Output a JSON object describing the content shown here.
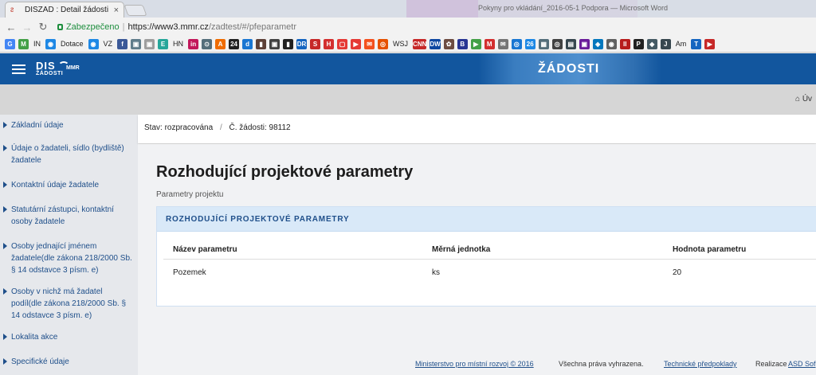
{
  "browser": {
    "tab_title": "DISZAD : Detail žádosti",
    "tab_close": "×",
    "background_window_text": "Pokyny pro vkládání_2016-05-1 Podpora — Microsoft Word",
    "security_label": "Zabezpečeno",
    "url_host": "https://www3.mmr.cz",
    "url_path": "/zadtest/#/pfeparametr",
    "bookmarks": [
      {
        "label": "G",
        "color": "#4285f4"
      },
      {
        "label": "M",
        "color": "#43a047"
      },
      {
        "label": "IN",
        "color": "",
        "text": true
      },
      {
        "label": "◉",
        "color": "#1e88e5"
      },
      {
        "label": "Dotace",
        "color": "",
        "text": true
      },
      {
        "label": "◉",
        "color": "#1e88e5"
      },
      {
        "label": "VZ",
        "color": "",
        "text": true
      },
      {
        "label": "f",
        "color": "#3b5998"
      },
      {
        "label": "▣",
        "color": "#607d8b"
      },
      {
        "label": "▣",
        "color": "#9e9e9e"
      },
      {
        "label": "E",
        "color": "#26a69a"
      },
      {
        "label": "HN",
        "color": "",
        "text": true
      },
      {
        "label": "in",
        "color": "#c2185b"
      },
      {
        "label": "⊙",
        "color": "#546e7a"
      },
      {
        "label": "A",
        "color": "#ef6c00"
      },
      {
        "label": "24",
        "color": "#212121"
      },
      {
        "label": "d",
        "color": "#1976d2"
      },
      {
        "label": "▮",
        "color": "#5d4037"
      },
      {
        "label": "▣",
        "color": "#424242"
      },
      {
        "label": "▮",
        "color": "#212121"
      },
      {
        "label": "DR",
        "color": "#1565c0"
      },
      {
        "label": "S",
        "color": "#c62828"
      },
      {
        "label": "H",
        "color": "#d32f2f"
      },
      {
        "label": "▢",
        "color": "#e53935"
      },
      {
        "label": "▶",
        "color": "#e53935"
      },
      {
        "label": "✉",
        "color": "#f4511e"
      },
      {
        "label": "◎",
        "color": "#e65100"
      },
      {
        "label": "WSJ",
        "color": "",
        "text": true
      },
      {
        "label": "CNN",
        "color": "#c62828"
      },
      {
        "label": "DW",
        "color": "#0d47a1"
      },
      {
        "label": "✿",
        "color": "#6d4c41"
      },
      {
        "label": "B",
        "color": "#283593"
      },
      {
        "label": "▶",
        "color": "#43a047"
      },
      {
        "label": "M",
        "color": "#d32f2f"
      },
      {
        "label": "✉",
        "color": "#757575"
      },
      {
        "label": "◎",
        "color": "#1976d2"
      },
      {
        "label": "26",
        "color": "#1e88e5"
      },
      {
        "label": "▦",
        "color": "#546e7a"
      },
      {
        "label": "◎",
        "color": "#424242"
      },
      {
        "label": "▤",
        "color": "#37474f"
      },
      {
        "label": "▣",
        "color": "#6a1b9a"
      },
      {
        "label": "◈",
        "color": "#0277bd"
      },
      {
        "label": "◉",
        "color": "#616161"
      },
      {
        "label": "II",
        "color": "#b71c1c"
      },
      {
        "label": "P",
        "color": "#212121"
      },
      {
        "label": "◆",
        "color": "#455a64"
      },
      {
        "label": "J",
        "color": "#37474f"
      },
      {
        "label": "Am",
        "color": "",
        "text": true
      },
      {
        "label": "T",
        "color": "#1565c0"
      },
      {
        "label": "▶",
        "color": "#c62828"
      }
    ]
  },
  "header": {
    "logo_main": "DIS",
    "logo_sub": "ŽÁDOSTI",
    "logo_mmr": "MMR",
    "banner_title": "ŽÁDOSTI"
  },
  "topbar": {
    "home_label": "Úv"
  },
  "sidebar": {
    "items": [
      {
        "label": "Základní údaje"
      },
      {
        "label": "Údaje o žadateli, sídlo (bydliště) žadatele"
      },
      {
        "label": "Kontaktní údaje žadatele"
      },
      {
        "label": "Statutární zástupci, kontaktní osoby žadatele"
      },
      {
        "label": "Osoby jednající jménem žadatele(dle zákona 218/2000 Sb. § 14 odstavce 3 písm. e)"
      },
      {
        "label": "Osoby v nichž má žadatel podíl(dle zákona 218/2000 Sb. § 14 odstavce 3 písm. e)"
      },
      {
        "label": "Lokalita akce"
      },
      {
        "label": "Specifické údaje"
      }
    ]
  },
  "status": {
    "state": "Stav: rozpracována",
    "separator": "/",
    "number": "Č. žádosti: 98112"
  },
  "main": {
    "title": "Rozhodující projektové parametry",
    "subtitle": "Parametry projektu",
    "panel_heading": "ROZHODUJÍCÍ PROJEKTOVÉ PARAMETRY",
    "columns": [
      "Název parametru",
      "Měrná jednotka",
      "Hodnota parametru"
    ],
    "rows": [
      [
        "Pozemek",
        "ks",
        "20"
      ]
    ]
  },
  "footer": {
    "ministry": "Ministerstvo pro místní rozvoj © 2016",
    "rights": "Všechna práva vyhrazena.",
    "tech": "Technické předpoklady",
    "realizace": "Realizace",
    "company": "ASD Sof"
  }
}
